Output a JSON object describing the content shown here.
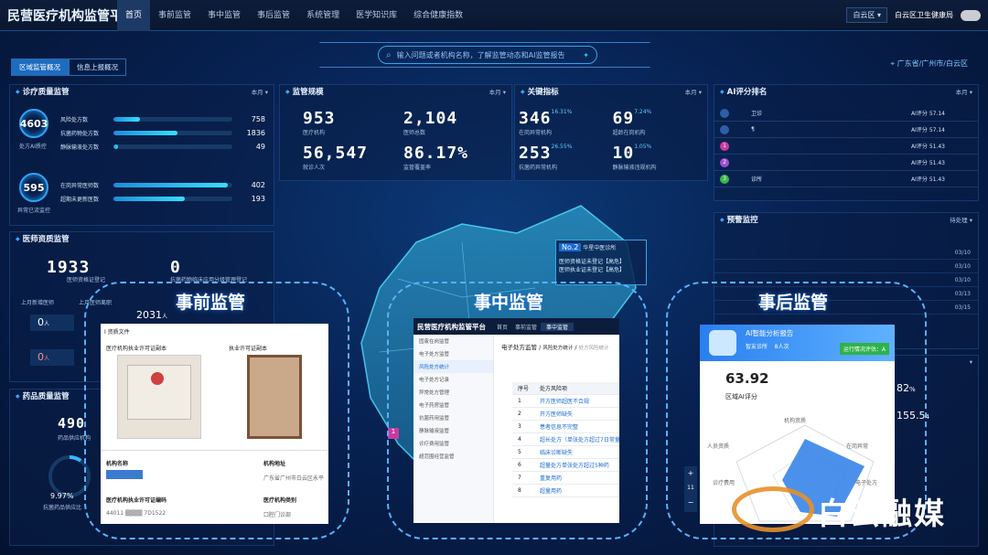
{
  "app": {
    "title": "民营医疗机构监管平台"
  },
  "nav": [
    {
      "label": "首页",
      "active": true
    },
    {
      "label": "事前监管"
    },
    {
      "label": "事中监管"
    },
    {
      "label": "事后监管"
    },
    {
      "label": "系统管理"
    },
    {
      "label": "医学知识库"
    },
    {
      "label": "综合健康指数"
    }
  ],
  "header": {
    "region": "白云区",
    "org": "白云区卫生健康局"
  },
  "search": {
    "placeholder": "输入问题或者机构名称，了解监管动态和AI监管报告"
  },
  "tabs": [
    {
      "label": "区域监管概况",
      "active": true
    },
    {
      "label": "信息上报概况"
    }
  ],
  "location": "广东省/广州市/白云区",
  "period": "本月",
  "period_all": "待处理",
  "quality": {
    "title": "诊疗质量监管",
    "ring1": {
      "value": "4603",
      "label": "处方AI质控"
    },
    "ring2": {
      "value": "595",
      "label": "异常已流监控"
    },
    "rows1": [
      {
        "label": "风险处方数",
        "value": "758",
        "pct": 22
      },
      {
        "label": "抗菌药物处方数",
        "value": "1836",
        "pct": 54
      },
      {
        "label": "静脉输液处方数",
        "value": "49",
        "pct": 4
      }
    ],
    "rows2": [
      {
        "label": "在岗异常医师数",
        "value": "402",
        "pct": 96
      },
      {
        "label": "超期未更新医数",
        "value": "193",
        "pct": 60
      }
    ]
  },
  "doctor": {
    "title": "医师资质监管",
    "v1": "1933",
    "l1": "医师资格证登记",
    "v2": "0",
    "l2": "抗菌药物临床应用分级管理登记",
    "col1": "上月新增医师",
    "col2": "上月医师离职",
    "s1": "0",
    "s1u": "人",
    "s2": "2031",
    "s2u": "人",
    "s3": "0",
    "s3u": "人"
  },
  "drug": {
    "title": "药品质量监管",
    "v1": "490",
    "l1": "药品供应机构",
    "gauge": "9.97%",
    "gl": "抗菌药品供应比"
  },
  "scale": {
    "title": "监管规模",
    "items": [
      {
        "v": "953",
        "l": "医疗机构"
      },
      {
        "v": "2,104",
        "l": "医师总数"
      },
      {
        "v": "56,547",
        "l": "就诊人次"
      },
      {
        "v": "86.17%",
        "l": "监管覆盖率"
      }
    ]
  },
  "kpi": {
    "title": "关键指标",
    "items": [
      {
        "v": "346",
        "p": "16.31%",
        "l": "在岗异常机构"
      },
      {
        "v": "69",
        "p": "7.24%",
        "l": "超龄在岗机构"
      },
      {
        "v": "253",
        "p": "26.55%",
        "l": "抗菌药异常机构"
      },
      {
        "v": "10",
        "p": "1.05%",
        "l": "静脉输液违规机构"
      }
    ]
  },
  "ai_rank": {
    "title": "AI评分排名",
    "rows": [
      {
        "n": "",
        "name": "卫诊",
        "score": "AI评分 57.14",
        "c": "#2d5ea8"
      },
      {
        "n": "",
        "name": "¶",
        "score": "AI评分 57.14",
        "c": "#2d5ea8"
      },
      {
        "n": "1",
        "name": "",
        "score": "AI评分 51.43",
        "c": "#c83aa0"
      },
      {
        "n": "2",
        "name": "",
        "score": "AI评分 51.43",
        "c": "#9a4fd0"
      },
      {
        "n": "3",
        "name": "诊所",
        "score": "AI评分 51.43",
        "c": "#3ab54a"
      }
    ]
  },
  "warning": {
    "title": "预警监控",
    "dates": [
      "03/10",
      "03/10",
      "03/10",
      "03/13",
      "03/15"
    ]
  },
  "map_popup": {
    "rank": "No.2",
    "name": "华星中医诊所",
    "line1": "医师资格证未登记【高危】",
    "line2": "医师执业证未登记【高危】"
  },
  "overlay": {
    "pre": "事前监管",
    "mid": "事中监管",
    "post": "事后监管"
  },
  "pre_card": {
    "head": "I 资质文件",
    "c1": "医疗机构执业许可证副本",
    "c2": "执业许可证副本",
    "f1": "机构名称",
    "f2": "机构地址",
    "v2": "广东省广州市白云区永平",
    "f3": "医疗机构执业许可证编码",
    "f4": "医疗机构类别",
    "v3": "44011",
    "v3b": "7D1522",
    "v4": "口腔门诊部"
  },
  "mid_card": {
    "title": "民营医疗机构监管平台",
    "tabs": [
      "首页",
      "事前监管",
      "事中监管"
    ],
    "menu": [
      "固废在岗监管",
      "电子处方监管",
      "风险处方统计",
      "电子处方记录",
      "异常处方管理",
      "电子药房监管",
      "抗菌药用监管",
      "静脉输液监管",
      "诊疗费用监管",
      "超范围经营监管"
    ],
    "crumb": "电子处方监管",
    "crumb2": "风险处方统计",
    "crumb3": "处方风险统计",
    "col1": "序号",
    "col2": "处方风险项",
    "rows": [
      "开方医师超医不合规",
      "开方医师缺失",
      "患者信息不完整",
      "超长处方（单张处方超过7日常量）",
      "临床诊断缺失",
      "超量处方单张处方超过5种药",
      "重复用药",
      "超量用药"
    ]
  },
  "post_card": {
    "title": "AI智能分析报告",
    "sub": "智友诊所",
    "count": "8人次",
    "btn": "运行情况评估：A",
    "score": "63.92",
    "scorel": "区域AI评分",
    "axes": [
      "机构资质",
      "人员资质",
      "在岗异常",
      "诊疗费用",
      "电子处方"
    ]
  },
  "side_nums": {
    "n1": "82",
    "u1": "%",
    "n2": "155.5",
    "u2": "4"
  },
  "map_marker": "1",
  "zoom": {
    "plus": "+",
    "level": "11",
    "minus": "−"
  },
  "watermark": "白云融媒"
}
